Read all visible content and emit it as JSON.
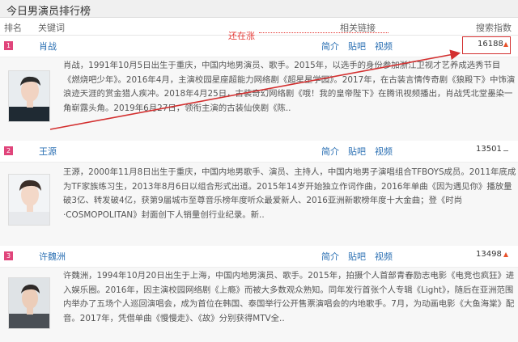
{
  "page": {
    "title": "今日男演员排行榜"
  },
  "header": {
    "rank": "排名",
    "keyword": "关键词",
    "links": "相关链接",
    "index": "搜索指数"
  },
  "annotation": {
    "note": "还在涨",
    "color": "#e53935"
  },
  "link_labels": {
    "intro": "简介",
    "tieba": "贴吧",
    "video": "视频"
  },
  "rows": [
    {
      "rank": "1",
      "name": "肖战",
      "index": "16188",
      "trend": "up",
      "description": "肖战，1991年10月5日出生于重庆，中国内地男演员、歌手。2015年，以选手的身份参加浙江卫视才艺养成选秀节目《燃烧吧少年》。2016年4月，主演校园星座超能力网络剧《超星星学园》。2017年，在古装言情传奇剧《狼殿下》中饰演浪迹天涯的赏金猎人疾冲。2018年4月25日，古装奇幻网络剧《哦！我的皇帝陛下》在腾讯视频播出，肖战凭北堂墨染一角崭露头角。2019年6月27日，领衔主演的古装仙侠剧《陈.."
    },
    {
      "rank": "2",
      "name": "王源",
      "index": "13501",
      "trend": "flat",
      "description": "王源，2000年11月8日出生于重庆，中国内地男歌手、演员、主持人，中国内地男子演唱组合TFBOYS成员。2011年底成为TF家族练习生，2013年8月6日以组合形式出道。2015年14岁开始独立作词作曲，2016年单曲《因为遇见你》播放量破3亿、转发破4亿，获第9届城市至尊音乐榜年度听众最爱新人、2016亚洲新歌榜年度十大金曲；登《时尚·COSMOPOLITAN》封面创下人销量创行业纪录。新.."
    },
    {
      "rank": "3",
      "name": "许魏洲",
      "index": "13498",
      "trend": "up",
      "description": "许魏洲，1994年10月20日出生于上海，中国内地男演员、歌手。2015年，拍摄个人首部青春励志电影《电竞也疯狂》进入娱乐圈。2016年，因主演校园网络剧《上瘾》而被大多数观众熟知。同年发行首张个人专辑《Light》，随后在亚洲范围内举办了五场个人巡回演唱会，成为首位在韩国、泰国举行公开售票演唱会的内地歌手。7月，为动画电影《大鱼海棠》配音。2017年，凭借单曲《慢慢走》、《故》分别获得MTV全.."
    }
  ]
}
